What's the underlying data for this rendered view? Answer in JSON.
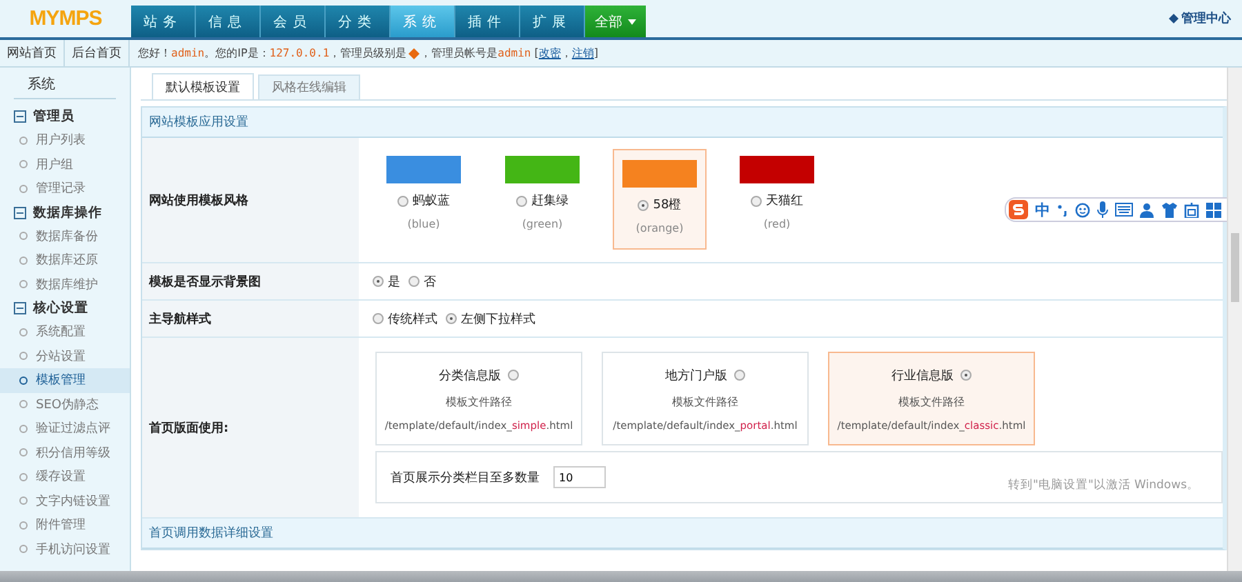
{
  "logo": "MYMPS",
  "nav": [
    {
      "label": "站务",
      "selected": false,
      "kind": "tab"
    },
    {
      "label": "信息",
      "selected": false,
      "kind": "tab"
    },
    {
      "label": "会员",
      "selected": false,
      "kind": "tab"
    },
    {
      "label": "分类",
      "selected": false,
      "kind": "tab"
    },
    {
      "label": "系统",
      "selected": true,
      "kind": "tab"
    },
    {
      "label": "插件",
      "selected": false,
      "kind": "tab"
    },
    {
      "label": "扩展",
      "selected": false,
      "kind": "tab"
    },
    {
      "label": "全部",
      "selected": false,
      "kind": "dropdown"
    }
  ],
  "admin_center": "管理中心",
  "quick_links": [
    "网站首页",
    "后台首页"
  ],
  "welcome": {
    "greeting": "您好！",
    "user": "admin",
    "ip_label": "。您的IP是：",
    "ip": "127.0.0.1",
    "level_label": "，管理员级别是",
    "account_label": "，管理员帐号是",
    "account": "admin",
    "open": " [",
    "change_password": "改密",
    "sep": "，",
    "logout": "注销",
    "close": "]"
  },
  "sidebar": {
    "title": "系统",
    "groups": [
      {
        "label": "管理员",
        "expanded": true,
        "children": [
          {
            "label": "用户列表",
            "selected": false
          },
          {
            "label": "用户组",
            "selected": false
          },
          {
            "label": "管理记录",
            "selected": false
          }
        ]
      },
      {
        "label": "数据库操作",
        "expanded": true,
        "children": [
          {
            "label": "数据库备份",
            "selected": false
          },
          {
            "label": "数据库还原",
            "selected": false
          },
          {
            "label": "数据库维护",
            "selected": false
          }
        ]
      },
      {
        "label": "核心设置",
        "expanded": true,
        "children": [
          {
            "label": "系统配置",
            "selected": false
          },
          {
            "label": "分站设置",
            "selected": false
          },
          {
            "label": "模板管理",
            "selected": true
          },
          {
            "label": "SEO伪静态",
            "selected": false
          },
          {
            "label": "验证过滤点评",
            "selected": false
          },
          {
            "label": "积分信用等级",
            "selected": false
          },
          {
            "label": "缓存设置",
            "selected": false
          },
          {
            "label": "文字内链设置",
            "selected": false
          },
          {
            "label": "附件管理",
            "selected": false
          },
          {
            "label": "手机访问设置",
            "selected": false
          }
        ]
      }
    ]
  },
  "tabs": [
    {
      "label": "默认模板设置",
      "selected": true
    },
    {
      "label": "风格在线编辑",
      "selected": false
    }
  ],
  "section_title": "网站模板应用设置",
  "style_row": {
    "label": "网站使用模板风格",
    "options": [
      {
        "name": "蚂蚁蓝",
        "code": "(blue)",
        "color": "#3a8ee0",
        "selected": false
      },
      {
        "name": "赶集绿",
        "code": "(green)",
        "color": "#44b615",
        "selected": false
      },
      {
        "name": "58橙",
        "code": "(orange)",
        "color": "#f5821f",
        "selected": true
      },
      {
        "name": "天猫红",
        "code": "(red)",
        "color": "#c40000",
        "selected": false
      }
    ]
  },
  "bg_row": {
    "label": "模板是否显示背景图",
    "options": [
      {
        "label": "是",
        "selected": true
      },
      {
        "label": "否",
        "selected": false
      }
    ]
  },
  "nav_row": {
    "label": "主导航样式",
    "options": [
      {
        "label": "传统样式",
        "selected": false
      },
      {
        "label": "左侧下拉样式",
        "selected": true
      }
    ]
  },
  "layout_row": {
    "label": "首页版面使用:",
    "cards": [
      {
        "name": "分类信息版",
        "path_label": "模板文件路径",
        "path_prefix": "/template/default/index_",
        "path_key": "simple",
        "path_suffix": ".html",
        "selected": false
      },
      {
        "name": "地方门户版",
        "path_label": "模板文件路径",
        "path_prefix": "/template/default/index_",
        "path_key": "portal",
        "path_suffix": ".html",
        "selected": false
      },
      {
        "name": "行业信息版",
        "path_label": "模板文件路径",
        "path_prefix": "/template/default/index_",
        "path_key": "classic",
        "path_suffix": ".html",
        "selected": true
      }
    ],
    "count_label": "首页展示分类栏目至多数量",
    "count_value": "10"
  },
  "next_section_title": "首页调用数据详细设置",
  "ime_bar": {
    "mode": "中"
  },
  "windows_notice": "转到\"电脑设置\"以激活 Windows。"
}
